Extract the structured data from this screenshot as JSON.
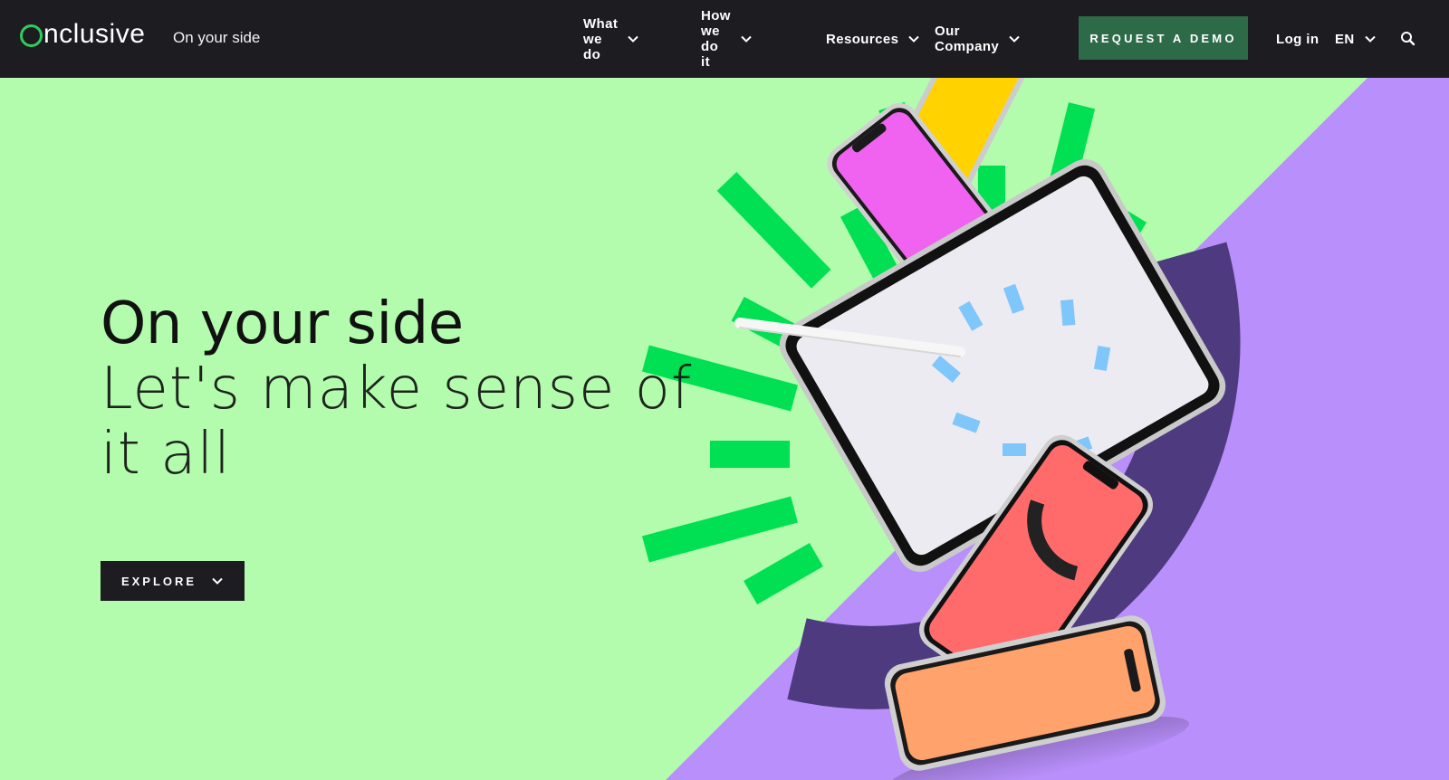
{
  "brand": {
    "logo_text": "nclusive",
    "logo_label": "Onclusive",
    "tagline": "On your side",
    "accent_color": "#2ecc5c"
  },
  "nav": {
    "items": [
      {
        "label": "What we do"
      },
      {
        "label": "How we do it"
      },
      {
        "label": "Resources"
      },
      {
        "label": "Our Company"
      }
    ],
    "demo_label": "REQUEST A DEMO",
    "login_label": "Log in",
    "language_label": "EN",
    "search_icon": "search-icon"
  },
  "hero": {
    "headline": "On your side",
    "subheadline": "Let's make sense of it all",
    "explore_label": "EXPLORE",
    "colors": {
      "background_green": "#b3fcad",
      "purple": "#b98ffb",
      "dark_purple": "#4e3a7e",
      "burst_green": "#00e052"
    }
  }
}
